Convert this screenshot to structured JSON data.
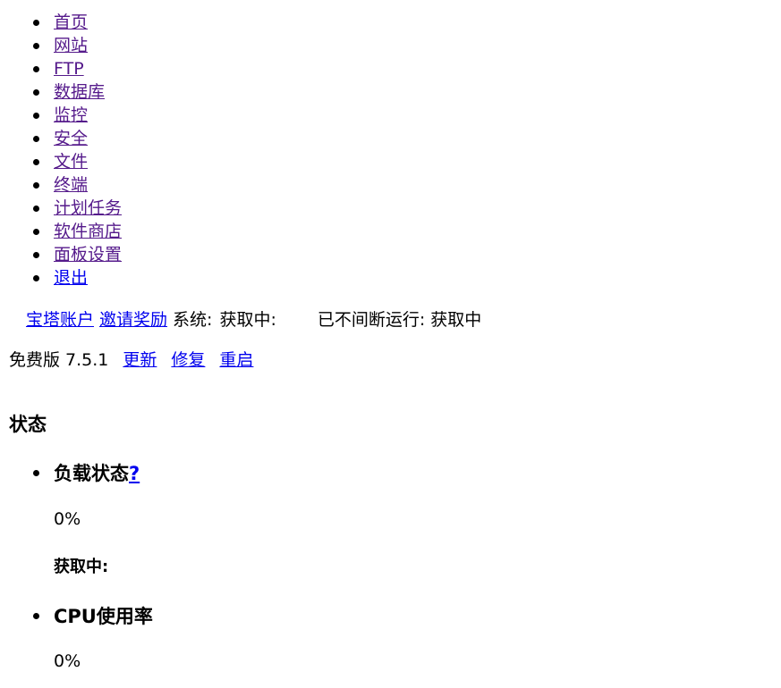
{
  "nav": {
    "items": [
      {
        "label": "首页",
        "visited": true
      },
      {
        "label": "网站",
        "visited": true
      },
      {
        "label": "FTP",
        "visited": true
      },
      {
        "label": "数据库",
        "visited": true
      },
      {
        "label": "监控",
        "visited": true
      },
      {
        "label": "安全",
        "visited": true
      },
      {
        "label": "文件",
        "visited": true
      },
      {
        "label": "终端",
        "visited": true
      },
      {
        "label": "计划任务",
        "visited": true
      },
      {
        "label": "软件商店",
        "visited": true
      },
      {
        "label": "面板设置",
        "visited": true
      },
      {
        "label": "退出",
        "visited": false
      }
    ]
  },
  "account": {
    "account_link": "宝塔账户",
    "invite_link": "邀请奖励",
    "system_label": "系统:",
    "system_value": "获取中:",
    "uptime_label": "已不间断运行:",
    "uptime_value": "获取中"
  },
  "version": {
    "text": "免费版 7.5.1",
    "update_link": "更新",
    "repair_link": "修复",
    "restart_link": "重启"
  },
  "status": {
    "title": "状态",
    "load": {
      "title": "负载状态",
      "help_link": "?",
      "value": "0%",
      "detail": "获取中:"
    },
    "cpu": {
      "title": "CPU使用率",
      "value": "0%"
    }
  },
  "colors": {
    "link": "#0000ee",
    "visited": "#551a8b"
  }
}
